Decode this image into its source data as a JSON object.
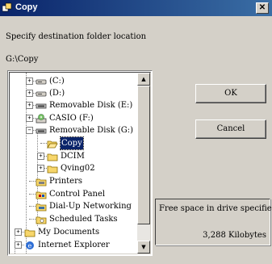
{
  "window": {
    "title": "Copy",
    "close_label": "✕"
  },
  "prompt": "Specify destination folder location",
  "path": "G:\\Copy",
  "tree": [
    {
      "label": "(C:)",
      "icon": "hard-drive-icon",
      "expander": "+"
    },
    {
      "label": "(D:)",
      "icon": "hard-drive-icon",
      "expander": "+"
    },
    {
      "label": "Removable Disk (E:)",
      "icon": "removable-disk-icon",
      "expander": "+"
    },
    {
      "label": "CASIO (F:)",
      "icon": "cd-drive-icon",
      "expander": "+"
    },
    {
      "label": "Removable Disk (G:)",
      "icon": "removable-disk-icon",
      "expander": "−"
    },
    {
      "label": "Copy",
      "icon": "folder-open-icon",
      "expander": "",
      "selected": true
    },
    {
      "label": "DCIM",
      "icon": "folder-icon",
      "expander": "+"
    },
    {
      "label": "Qving02",
      "icon": "folder-icon",
      "expander": "+"
    },
    {
      "label": "Printers",
      "icon": "printers-icon",
      "expander": ""
    },
    {
      "label": "Control Panel",
      "icon": "control-panel-icon",
      "expander": ""
    },
    {
      "label": "Dial-Up Networking",
      "icon": "dialup-icon",
      "expander": ""
    },
    {
      "label": "Scheduled Tasks",
      "icon": "scheduled-tasks-icon",
      "expander": ""
    },
    {
      "label": "My Documents",
      "icon": "folder-icon",
      "expander": "+"
    },
    {
      "label": "Internet Explorer",
      "icon": "internet-explorer-icon",
      "expander": "+"
    }
  ],
  "buttons": {
    "ok": "OK",
    "cancel": "Cancel"
  },
  "free_space": {
    "label": "Free space in drive specified",
    "value": "3,288  Kilobytes"
  },
  "colors": {
    "titlebar": "#0a246a",
    "selection": "#0a246a",
    "face": "#d4d0c8"
  }
}
